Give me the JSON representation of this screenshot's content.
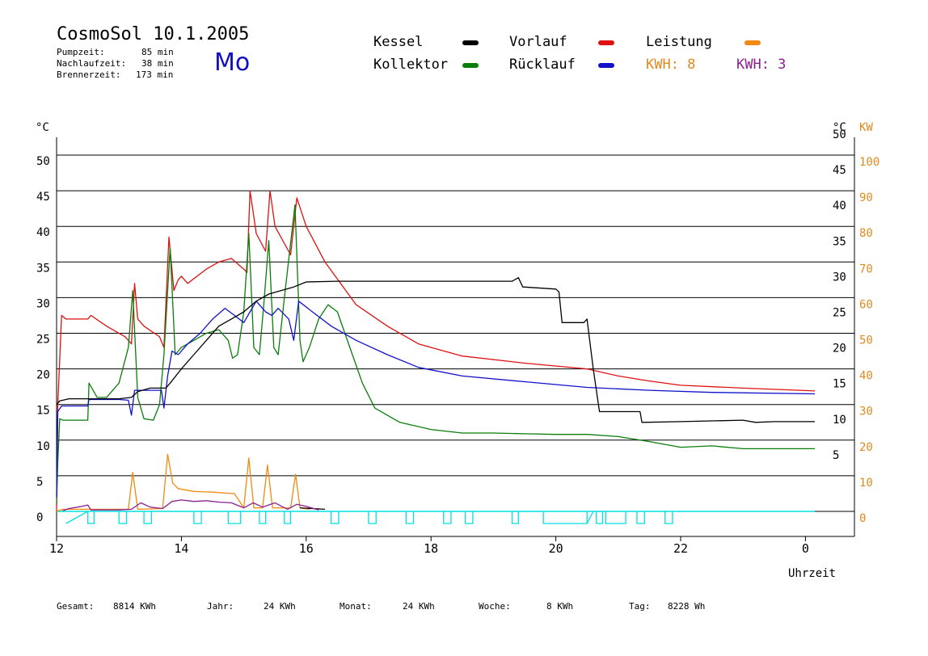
{
  "header": {
    "title": "CosmoSol 10.1.2005",
    "day": "Mo",
    "stats": [
      {
        "label": "Pumpzeit:",
        "value": "85 min"
      },
      {
        "label": "Nachlaufzeit:",
        "value": "38 min"
      },
      {
        "label": "Brennerzeit:",
        "value": "173 min"
      }
    ]
  },
  "legend": {
    "kessel": {
      "label": "Kessel",
      "color": "#000000"
    },
    "kollektor": {
      "label": "Kollektor",
      "color": "#0a7d0a"
    },
    "vorlauf": {
      "label": "Vorlauf",
      "color": "#dd1111"
    },
    "ruecklauf": {
      "label": "Rücklauf",
      "color": "#1111cc"
    },
    "leistung": {
      "label": "Leistung",
      "color": "#f08a10"
    },
    "kwh1": {
      "label": "KWH: 8",
      "color": "#e08a20"
    },
    "kwh2": {
      "label": "KWH: 3",
      "color": "#8a2090"
    }
  },
  "footer": {
    "gesamt_label": "Gesamt:",
    "gesamt_value": "8814 KWh",
    "jahr_label": "Jahr:",
    "jahr_value": "24 KWh",
    "monat_label": "Monat:",
    "monat_value": "24 KWh",
    "woche_label": "Woche:",
    "woche_value": "8 KWh",
    "tag_label": "Tag:",
    "tag_value": "8228 Wh"
  },
  "chart_data": {
    "type": "line",
    "xlabel": "Uhrzeit",
    "ylabel_left": "°C",
    "ylabel_right": "°C",
    "ylabel_right2": "KW",
    "x_range": [
      12,
      24.3
    ],
    "x_ticks": [
      {
        "value": 12,
        "label": "12"
      },
      {
        "value": 14,
        "label": "14"
      },
      {
        "value": 16,
        "label": "16"
      },
      {
        "value": 18,
        "label": "18"
      },
      {
        "value": 20,
        "label": "20"
      },
      {
        "value": 22,
        "label": "22"
      },
      {
        "value": 24,
        "label": "0"
      }
    ],
    "ylim": [
      0,
      50
    ],
    "y_ticks_left": [
      "0",
      "5",
      "10",
      "15",
      "20",
      "25",
      "30",
      "35",
      "40",
      "45",
      "50"
    ],
    "y_ticks_right": [
      "",
      "5",
      "10",
      "15",
      "20",
      "25",
      "30",
      "35",
      "40",
      "45",
      "50"
    ],
    "y_ticks_kw": [
      "0",
      "10",
      "20",
      "30",
      "40",
      "50",
      "60",
      "70",
      "80",
      "90",
      "100"
    ],
    "grid": true,
    "series": [
      {
        "name": "Vorlauf",
        "color": "#dd1111",
        "points": [
          [
            12.0,
            0
          ],
          [
            12.02,
            15
          ],
          [
            12.08,
            27.5
          ],
          [
            12.15,
            27
          ],
          [
            12.5,
            27
          ],
          [
            12.55,
            27.5
          ],
          [
            12.8,
            26
          ],
          [
            13.1,
            24.5
          ],
          [
            13.2,
            23.5
          ],
          [
            13.25,
            32
          ],
          [
            13.3,
            27
          ],
          [
            13.4,
            26
          ],
          [
            13.65,
            24.5
          ],
          [
            13.72,
            23
          ],
          [
            13.8,
            38.5
          ],
          [
            13.88,
            31
          ],
          [
            13.95,
            32.5
          ],
          [
            14.0,
            33
          ],
          [
            14.1,
            32
          ],
          [
            14.4,
            34
          ],
          [
            14.6,
            35
          ],
          [
            14.8,
            35.5
          ],
          [
            15.0,
            34
          ],
          [
            15.05,
            33.5
          ],
          [
            15.1,
            45
          ],
          [
            15.2,
            39
          ],
          [
            15.35,
            36.5
          ],
          [
            15.42,
            45
          ],
          [
            15.5,
            40
          ],
          [
            15.75,
            36
          ],
          [
            15.85,
            44
          ],
          [
            16.0,
            40
          ],
          [
            16.3,
            35
          ],
          [
            16.8,
            29
          ],
          [
            17.3,
            26
          ],
          [
            17.8,
            23.5
          ],
          [
            18.5,
            21.8
          ],
          [
            19.5,
            20.8
          ],
          [
            20.5,
            20
          ],
          [
            21.0,
            19
          ],
          [
            21.5,
            18.3
          ],
          [
            22.0,
            17.7
          ],
          [
            23.0,
            17.3
          ],
          [
            24.15,
            16.9
          ]
        ]
      },
      {
        "name": "Kollektor",
        "color": "#0a7d0a",
        "points": [
          [
            12.0,
            1
          ],
          [
            12.02,
            7
          ],
          [
            12.05,
            13
          ],
          [
            12.1,
            12.8
          ],
          [
            12.5,
            12.8
          ],
          [
            12.52,
            18
          ],
          [
            12.65,
            16
          ],
          [
            12.8,
            16
          ],
          [
            13.0,
            18
          ],
          [
            13.15,
            23
          ],
          [
            13.22,
            31
          ],
          [
            13.3,
            16
          ],
          [
            13.4,
            13
          ],
          [
            13.55,
            12.8
          ],
          [
            13.65,
            15
          ],
          [
            13.72,
            22
          ],
          [
            13.82,
            37
          ],
          [
            13.9,
            22
          ],
          [
            14.0,
            23
          ],
          [
            14.2,
            24
          ],
          [
            14.4,
            25
          ],
          [
            14.6,
            25.5
          ],
          [
            14.75,
            24
          ],
          [
            14.82,
            21.5
          ],
          [
            14.9,
            22
          ],
          [
            15.0,
            28
          ],
          [
            15.08,
            39
          ],
          [
            15.16,
            23
          ],
          [
            15.25,
            22
          ],
          [
            15.32,
            29
          ],
          [
            15.4,
            38
          ],
          [
            15.48,
            23
          ],
          [
            15.55,
            22
          ],
          [
            15.65,
            30
          ],
          [
            15.82,
            43
          ],
          [
            15.9,
            24
          ],
          [
            15.95,
            21
          ],
          [
            16.05,
            23
          ],
          [
            16.2,
            27
          ],
          [
            16.35,
            29
          ],
          [
            16.5,
            28
          ],
          [
            16.7,
            23
          ],
          [
            16.9,
            18
          ],
          [
            17.1,
            14.5
          ],
          [
            17.5,
            12.5
          ],
          [
            18.0,
            11.5
          ],
          [
            18.5,
            11
          ],
          [
            19.0,
            11
          ],
          [
            19.5,
            10.9
          ],
          [
            20.0,
            10.8
          ],
          [
            20.5,
            10.8
          ],
          [
            21.0,
            10.5
          ],
          [
            21.5,
            9.8
          ],
          [
            22.0,
            9.0
          ],
          [
            22.5,
            9.2
          ],
          [
            23.0,
            8.8
          ],
          [
            23.5,
            8.8
          ],
          [
            24.15,
            8.8
          ]
        ]
      },
      {
        "name": "Rücklauf",
        "color": "#1111cc",
        "points": [
          [
            12.0,
            2
          ],
          [
            12.02,
            14
          ],
          [
            12.08,
            14.8
          ],
          [
            12.5,
            14.8
          ],
          [
            12.52,
            15.7
          ],
          [
            13.0,
            15.7
          ],
          [
            13.15,
            15.6
          ],
          [
            13.2,
            13.5
          ],
          [
            13.25,
            17
          ],
          [
            13.5,
            17
          ],
          [
            13.68,
            17
          ],
          [
            13.72,
            14.5
          ],
          [
            13.78,
            19
          ],
          [
            13.85,
            22.5
          ],
          [
            13.95,
            22
          ],
          [
            14.1,
            23.5
          ],
          [
            14.3,
            25
          ],
          [
            14.5,
            27
          ],
          [
            14.7,
            28.5
          ],
          [
            14.85,
            27.5
          ],
          [
            15.0,
            26.5
          ],
          [
            15.1,
            28
          ],
          [
            15.2,
            29.5
          ],
          [
            15.35,
            28
          ],
          [
            15.45,
            27.5
          ],
          [
            15.55,
            28.5
          ],
          [
            15.72,
            27
          ],
          [
            15.8,
            24
          ],
          [
            15.88,
            29.5
          ],
          [
            16.1,
            28
          ],
          [
            16.4,
            26
          ],
          [
            16.8,
            24
          ],
          [
            17.3,
            22
          ],
          [
            17.8,
            20.2
          ],
          [
            18.5,
            19
          ],
          [
            19.5,
            18.2
          ],
          [
            20.5,
            17.4
          ],
          [
            21.5,
            17
          ],
          [
            22.5,
            16.7
          ],
          [
            24.15,
            16.5
          ]
        ]
      },
      {
        "name": "Kessel",
        "color": "#000000",
        "points": [
          [
            12.0,
            15
          ],
          [
            12.05,
            15.5
          ],
          [
            12.2,
            15.8
          ],
          [
            13.0,
            15.8
          ],
          [
            13.2,
            16
          ],
          [
            13.3,
            16.8
          ],
          [
            13.5,
            17.3
          ],
          [
            13.75,
            17.3
          ],
          [
            13.82,
            18
          ],
          [
            14.0,
            20
          ],
          [
            14.2,
            22
          ],
          [
            14.4,
            24
          ],
          [
            14.6,
            26
          ],
          [
            14.8,
            27
          ],
          [
            15.0,
            28
          ],
          [
            15.2,
            29.5
          ],
          [
            15.4,
            30.5
          ],
          [
            15.6,
            31
          ],
          [
            15.8,
            31.5
          ],
          [
            16.0,
            32.2
          ],
          [
            16.5,
            32.3
          ],
          [
            17.5,
            32.3
          ],
          [
            18.5,
            32.3
          ],
          [
            19.3,
            32.3
          ],
          [
            19.4,
            32.8
          ],
          [
            19.47,
            31.5
          ],
          [
            20.0,
            31.2
          ],
          [
            20.05,
            30.8
          ],
          [
            20.1,
            26.5
          ],
          [
            20.45,
            26.5
          ],
          [
            20.5,
            27
          ],
          [
            20.6,
            20
          ],
          [
            20.7,
            14
          ],
          [
            21.35,
            14
          ],
          [
            21.38,
            12.5
          ],
          [
            22.0,
            12.6
          ],
          [
            23.0,
            12.8
          ],
          [
            23.2,
            12.5
          ],
          [
            23.5,
            12.6
          ],
          [
            24.15,
            12.6
          ]
        ]
      },
      {
        "name": "Leistung",
        "color": "#f08a10",
        "points": [
          [
            12.0,
            0
          ],
          [
            12.1,
            0.3
          ],
          [
            13.15,
            0.3
          ],
          [
            13.22,
            5.5
          ],
          [
            13.3,
            0.3
          ],
          [
            13.7,
            0.4
          ],
          [
            13.78,
            8
          ],
          [
            13.86,
            4
          ],
          [
            13.95,
            3.2
          ],
          [
            14.2,
            2.8
          ],
          [
            14.5,
            2.7
          ],
          [
            14.85,
            2.5
          ],
          [
            15.0,
            0.5
          ],
          [
            15.08,
            7.5
          ],
          [
            15.16,
            0.5
          ],
          [
            15.3,
            0.5
          ],
          [
            15.38,
            6.5
          ],
          [
            15.46,
            0.5
          ],
          [
            15.75,
            0.5
          ],
          [
            15.83,
            5.2
          ],
          [
            15.9,
            0.5
          ],
          [
            16.05,
            0.3
          ]
        ]
      },
      {
        "name": "Leistung-Kessel",
        "color": "#000000",
        "points": [
          [
            15.9,
            0.5
          ],
          [
            16.3,
            0.3
          ]
        ]
      },
      {
        "name": "Pumpe",
        "color": "#8a2090",
        "points": [
          [
            12.1,
            0.1
          ],
          [
            12.2,
            0.4
          ],
          [
            12.4,
            0.7
          ],
          [
            12.5,
            0.9
          ],
          [
            12.55,
            0.2
          ],
          [
            13.0,
            0.2
          ],
          [
            13.2,
            0.3
          ],
          [
            13.35,
            1.2
          ],
          [
            13.5,
            0.6
          ],
          [
            13.7,
            0.4
          ],
          [
            13.85,
            1.4
          ],
          [
            14.0,
            1.6
          ],
          [
            14.2,
            1.4
          ],
          [
            14.4,
            1.5
          ],
          [
            14.6,
            1.3
          ],
          [
            14.8,
            1.2
          ],
          [
            15.0,
            0.5
          ],
          [
            15.15,
            1.2
          ],
          [
            15.3,
            0.6
          ],
          [
            15.5,
            1.2
          ],
          [
            15.7,
            0.3
          ],
          [
            15.85,
            1.0
          ],
          [
            16.0,
            0.7
          ],
          [
            16.2,
            0.2
          ]
        ]
      },
      {
        "name": "Status",
        "color": "#00e0e0",
        "points": [
          [
            12.0,
            0
          ],
          [
            24.15,
            0
          ]
        ]
      }
    ],
    "status_pulses": [
      [
        12.5,
        12.6
      ],
      [
        13.0,
        13.12
      ],
      [
        13.4,
        13.52
      ],
      [
        14.2,
        14.32
      ],
      [
        14.75,
        14.95
      ],
      [
        15.25,
        15.35
      ],
      [
        15.65,
        15.75
      ],
      [
        16.4,
        16.52
      ],
      [
        17.0,
        17.12
      ],
      [
        17.6,
        17.72
      ],
      [
        18.2,
        18.32
      ],
      [
        18.55,
        18.67
      ],
      [
        19.3,
        19.4
      ],
      [
        19.8,
        20.5
      ],
      [
        20.65,
        20.75
      ],
      [
        20.8,
        21.12
      ],
      [
        21.3,
        21.42
      ],
      [
        21.75,
        21.87
      ]
    ]
  }
}
